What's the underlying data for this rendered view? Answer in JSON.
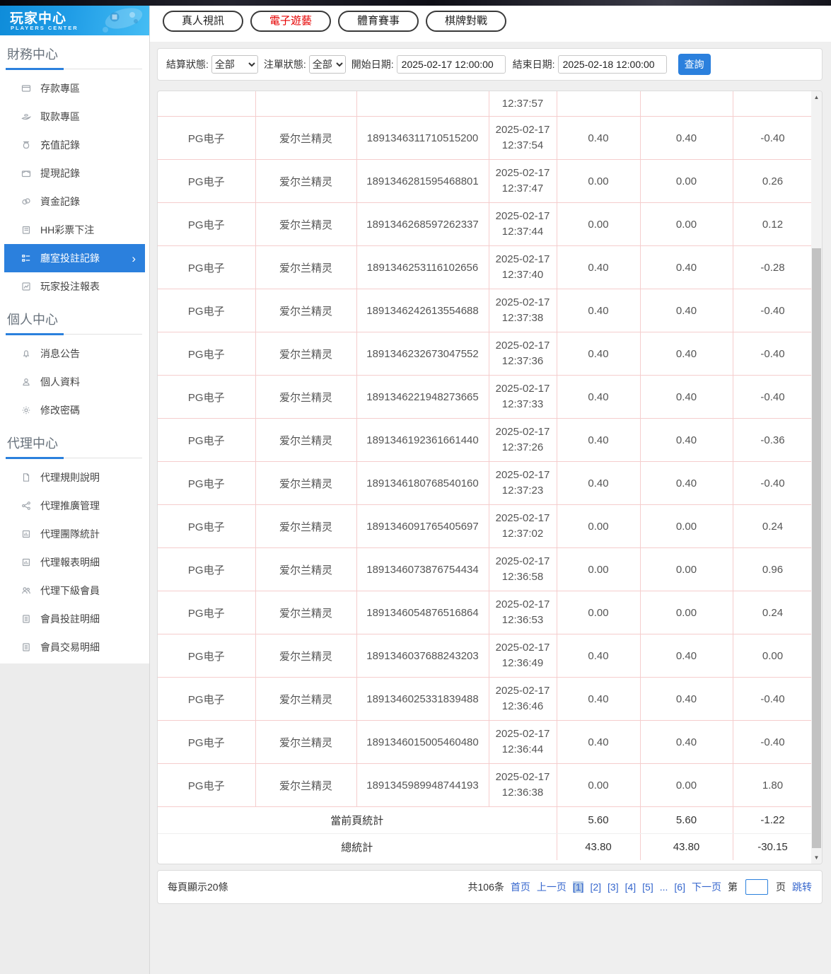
{
  "colors": {
    "accent": "#2b80dd",
    "tab_active_red": "#e60000",
    "link_blue": "#3566cd",
    "table_border_pink": "#f5cdcd",
    "current_page_bg": "#b5cbe7"
  },
  "sidebar": {
    "title": "玩家中心",
    "subtitle": "PLAYERS CENTER",
    "sections": [
      {
        "heading": "財務中心",
        "items": [
          {
            "name": "deposit-area",
            "icon": "deposit-icon",
            "label": "存款專區"
          },
          {
            "name": "withdraw-area",
            "icon": "withdraw-hand-icon",
            "label": "取款專區"
          },
          {
            "name": "recharge-records",
            "icon": "moneybag-icon",
            "label": "充值記錄"
          },
          {
            "name": "withdrawal-records",
            "icon": "envelope-icon",
            "label": "提現記錄"
          },
          {
            "name": "funds-records",
            "icon": "coins-icon",
            "label": "資金記錄"
          },
          {
            "name": "hh-lottery-bets",
            "icon": "notebook-icon",
            "label": "HH彩票下注"
          },
          {
            "name": "hall-bet-records",
            "icon": "list-boxes-icon",
            "label": "廳室投註記錄",
            "active": true,
            "arrow": "›"
          },
          {
            "name": "player-bet-report",
            "icon": "chart-icon",
            "label": "玩家投注報表"
          }
        ]
      },
      {
        "heading": "個人中心",
        "items": [
          {
            "name": "announcements",
            "icon": "bell-icon",
            "label": "消息公告"
          },
          {
            "name": "profile",
            "icon": "user-icon",
            "label": "個人資料"
          },
          {
            "name": "change-password",
            "icon": "gear-icon",
            "label": "修改密碼"
          }
        ]
      },
      {
        "heading": "代理中心",
        "items": [
          {
            "name": "agent-rules",
            "icon": "file-icon",
            "label": "代理規則說明"
          },
          {
            "name": "agent-promotion",
            "icon": "share-icon",
            "label": "代理推廣管理"
          },
          {
            "name": "agent-team-stats",
            "icon": "stats-icon",
            "label": "代理團隊統計"
          },
          {
            "name": "agent-report-detail",
            "icon": "stats-icon",
            "label": "代理報表明細"
          },
          {
            "name": "agent-sub-members",
            "icon": "users-icon",
            "label": "代理下級會員"
          },
          {
            "name": "member-bet-detail",
            "icon": "doc-list-icon",
            "label": "會員投註明細"
          },
          {
            "name": "member-transaction-detail",
            "icon": "doc-list-icon",
            "label": "會員交易明細"
          }
        ]
      }
    ]
  },
  "tabs": [
    {
      "name": "live-casino",
      "label": "真人視訊",
      "active": false
    },
    {
      "name": "electronic-games",
      "label": "電子遊藝",
      "active": true
    },
    {
      "name": "sports",
      "label": "體育賽事",
      "active": false
    },
    {
      "name": "chess-cards",
      "label": "棋牌對戰",
      "active": false
    }
  ],
  "filters": {
    "settle_status_label": "結算狀態:",
    "settle_status_value": "全部",
    "order_status_label": "注單狀態:",
    "order_status_value": "全部",
    "start_date_label": "開始日期:",
    "start_date_value": "2025-02-17 12:00:00",
    "end_date_label": "結束日期:",
    "end_date_value": "2025-02-18 12:00:00",
    "search_label": "查詢"
  },
  "table": {
    "partial_row_time": "12:37:57",
    "rows": [
      {
        "vendor": "PG电子",
        "game": "爱尔兰精灵",
        "order": "1891346311710515200",
        "date": "2025-02-17",
        "time": "12:37:54",
        "bet": "0.40",
        "valid": "0.40",
        "profit": "-0.40"
      },
      {
        "vendor": "PG电子",
        "game": "爱尔兰精灵",
        "order": "1891346281595468801",
        "date": "2025-02-17",
        "time": "12:37:47",
        "bet": "0.00",
        "valid": "0.00",
        "profit": "0.26"
      },
      {
        "vendor": "PG电子",
        "game": "爱尔兰精灵",
        "order": "1891346268597262337",
        "date": "2025-02-17",
        "time": "12:37:44",
        "bet": "0.00",
        "valid": "0.00",
        "profit": "0.12"
      },
      {
        "vendor": "PG电子",
        "game": "爱尔兰精灵",
        "order": "1891346253116102656",
        "date": "2025-02-17",
        "time": "12:37:40",
        "bet": "0.40",
        "valid": "0.40",
        "profit": "-0.28"
      },
      {
        "vendor": "PG电子",
        "game": "爱尔兰精灵",
        "order": "1891346242613554688",
        "date": "2025-02-17",
        "time": "12:37:38",
        "bet": "0.40",
        "valid": "0.40",
        "profit": "-0.40"
      },
      {
        "vendor": "PG电子",
        "game": "爱尔兰精灵",
        "order": "1891346232673047552",
        "date": "2025-02-17",
        "time": "12:37:36",
        "bet": "0.40",
        "valid": "0.40",
        "profit": "-0.40"
      },
      {
        "vendor": "PG电子",
        "game": "爱尔兰精灵",
        "order": "1891346221948273665",
        "date": "2025-02-17",
        "time": "12:37:33",
        "bet": "0.40",
        "valid": "0.40",
        "profit": "-0.40"
      },
      {
        "vendor": "PG电子",
        "game": "爱尔兰精灵",
        "order": "1891346192361661440",
        "date": "2025-02-17",
        "time": "12:37:26",
        "bet": "0.40",
        "valid": "0.40",
        "profit": "-0.36"
      },
      {
        "vendor": "PG电子",
        "game": "爱尔兰精灵",
        "order": "1891346180768540160",
        "date": "2025-02-17",
        "time": "12:37:23",
        "bet": "0.40",
        "valid": "0.40",
        "profit": "-0.40"
      },
      {
        "vendor": "PG电子",
        "game": "爱尔兰精灵",
        "order": "1891346091765405697",
        "date": "2025-02-17",
        "time": "12:37:02",
        "bet": "0.00",
        "valid": "0.00",
        "profit": "0.24"
      },
      {
        "vendor": "PG电子",
        "game": "爱尔兰精灵",
        "order": "1891346073876754434",
        "date": "2025-02-17",
        "time": "12:36:58",
        "bet": "0.00",
        "valid": "0.00",
        "profit": "0.96"
      },
      {
        "vendor": "PG电子",
        "game": "爱尔兰精灵",
        "order": "1891346054876516864",
        "date": "2025-02-17",
        "time": "12:36:53",
        "bet": "0.00",
        "valid": "0.00",
        "profit": "0.24"
      },
      {
        "vendor": "PG电子",
        "game": "爱尔兰精灵",
        "order": "1891346037688243203",
        "date": "2025-02-17",
        "time": "12:36:49",
        "bet": "0.40",
        "valid": "0.40",
        "profit": "0.00"
      },
      {
        "vendor": "PG电子",
        "game": "爱尔兰精灵",
        "order": "1891346025331839488",
        "date": "2025-02-17",
        "time": "12:36:46",
        "bet": "0.40",
        "valid": "0.40",
        "profit": "-0.40"
      },
      {
        "vendor": "PG电子",
        "game": "爱尔兰精灵",
        "order": "1891346015005460480",
        "date": "2025-02-17",
        "time": "12:36:44",
        "bet": "0.40",
        "valid": "0.40",
        "profit": "-0.40"
      },
      {
        "vendor": "PG电子",
        "game": "爱尔兰精灵",
        "order": "1891345989948744193",
        "date": "2025-02-17",
        "time": "12:36:38",
        "bet": "0.00",
        "valid": "0.00",
        "profit": "1.80"
      }
    ],
    "summary": [
      {
        "label": "當前頁統計",
        "values": [
          "5.60",
          "5.60",
          "-1.22"
        ]
      },
      {
        "label": "總統計",
        "values": [
          "43.80",
          "43.80",
          "-30.15"
        ]
      }
    ]
  },
  "pagination": {
    "per_page_text": "每頁顯示20條",
    "total_text": "共106条",
    "first_label": "首页",
    "prev_label": "上一页",
    "pages": [
      "[1]",
      "[2]",
      "[3]",
      "[4]",
      "[5]",
      "...",
      "[6]"
    ],
    "current_page": "[1]",
    "next_label": "下一页",
    "jump_prefix": "第",
    "jump_suffix": "页",
    "jump_label": "跳转"
  }
}
